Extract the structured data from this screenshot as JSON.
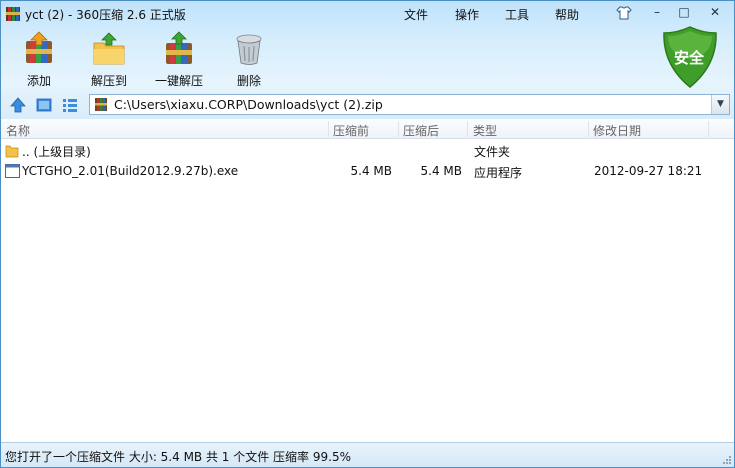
{
  "window": {
    "title": "yct (2) - 360压缩 2.6 正式版",
    "menu": [
      "文件",
      "操作",
      "工具",
      "帮助"
    ],
    "minimize": "–",
    "maximize": "□",
    "close": "✕"
  },
  "toolbar": {
    "add_label": "添加",
    "extract_to_label": "解压到",
    "one_click_extract_label": "一键解压",
    "delete_label": "删除",
    "security_label": "安全"
  },
  "address": {
    "path": "C:\\Users\\xiaxu.CORP\\Downloads\\yct (2).zip",
    "dropdown": "▼"
  },
  "columns": {
    "name": "名称",
    "compressed": "压缩前",
    "after": "压缩后",
    "type": "类型",
    "modified": "修改日期"
  },
  "rows": [
    {
      "name": ".. (上级目录)",
      "before": "",
      "after": "",
      "type": "文件夹",
      "date": "",
      "icon": "folder-icon"
    },
    {
      "name": "YCTGHO_2.01(Build2012.9.27b).exe",
      "before": "5.4 MB",
      "after": "5.4 MB",
      "type": "应用程序",
      "date": "2012-09-27 18:21",
      "icon": "exe-file-icon"
    }
  ],
  "status": {
    "text": "您打开了一个压缩文件 大小: 5.4 MB 共 1 个文件 压缩率 99.5%"
  },
  "colors": {
    "border": "#4c8fc5",
    "shield": "#3f9d2a",
    "header_text": "#666666"
  }
}
